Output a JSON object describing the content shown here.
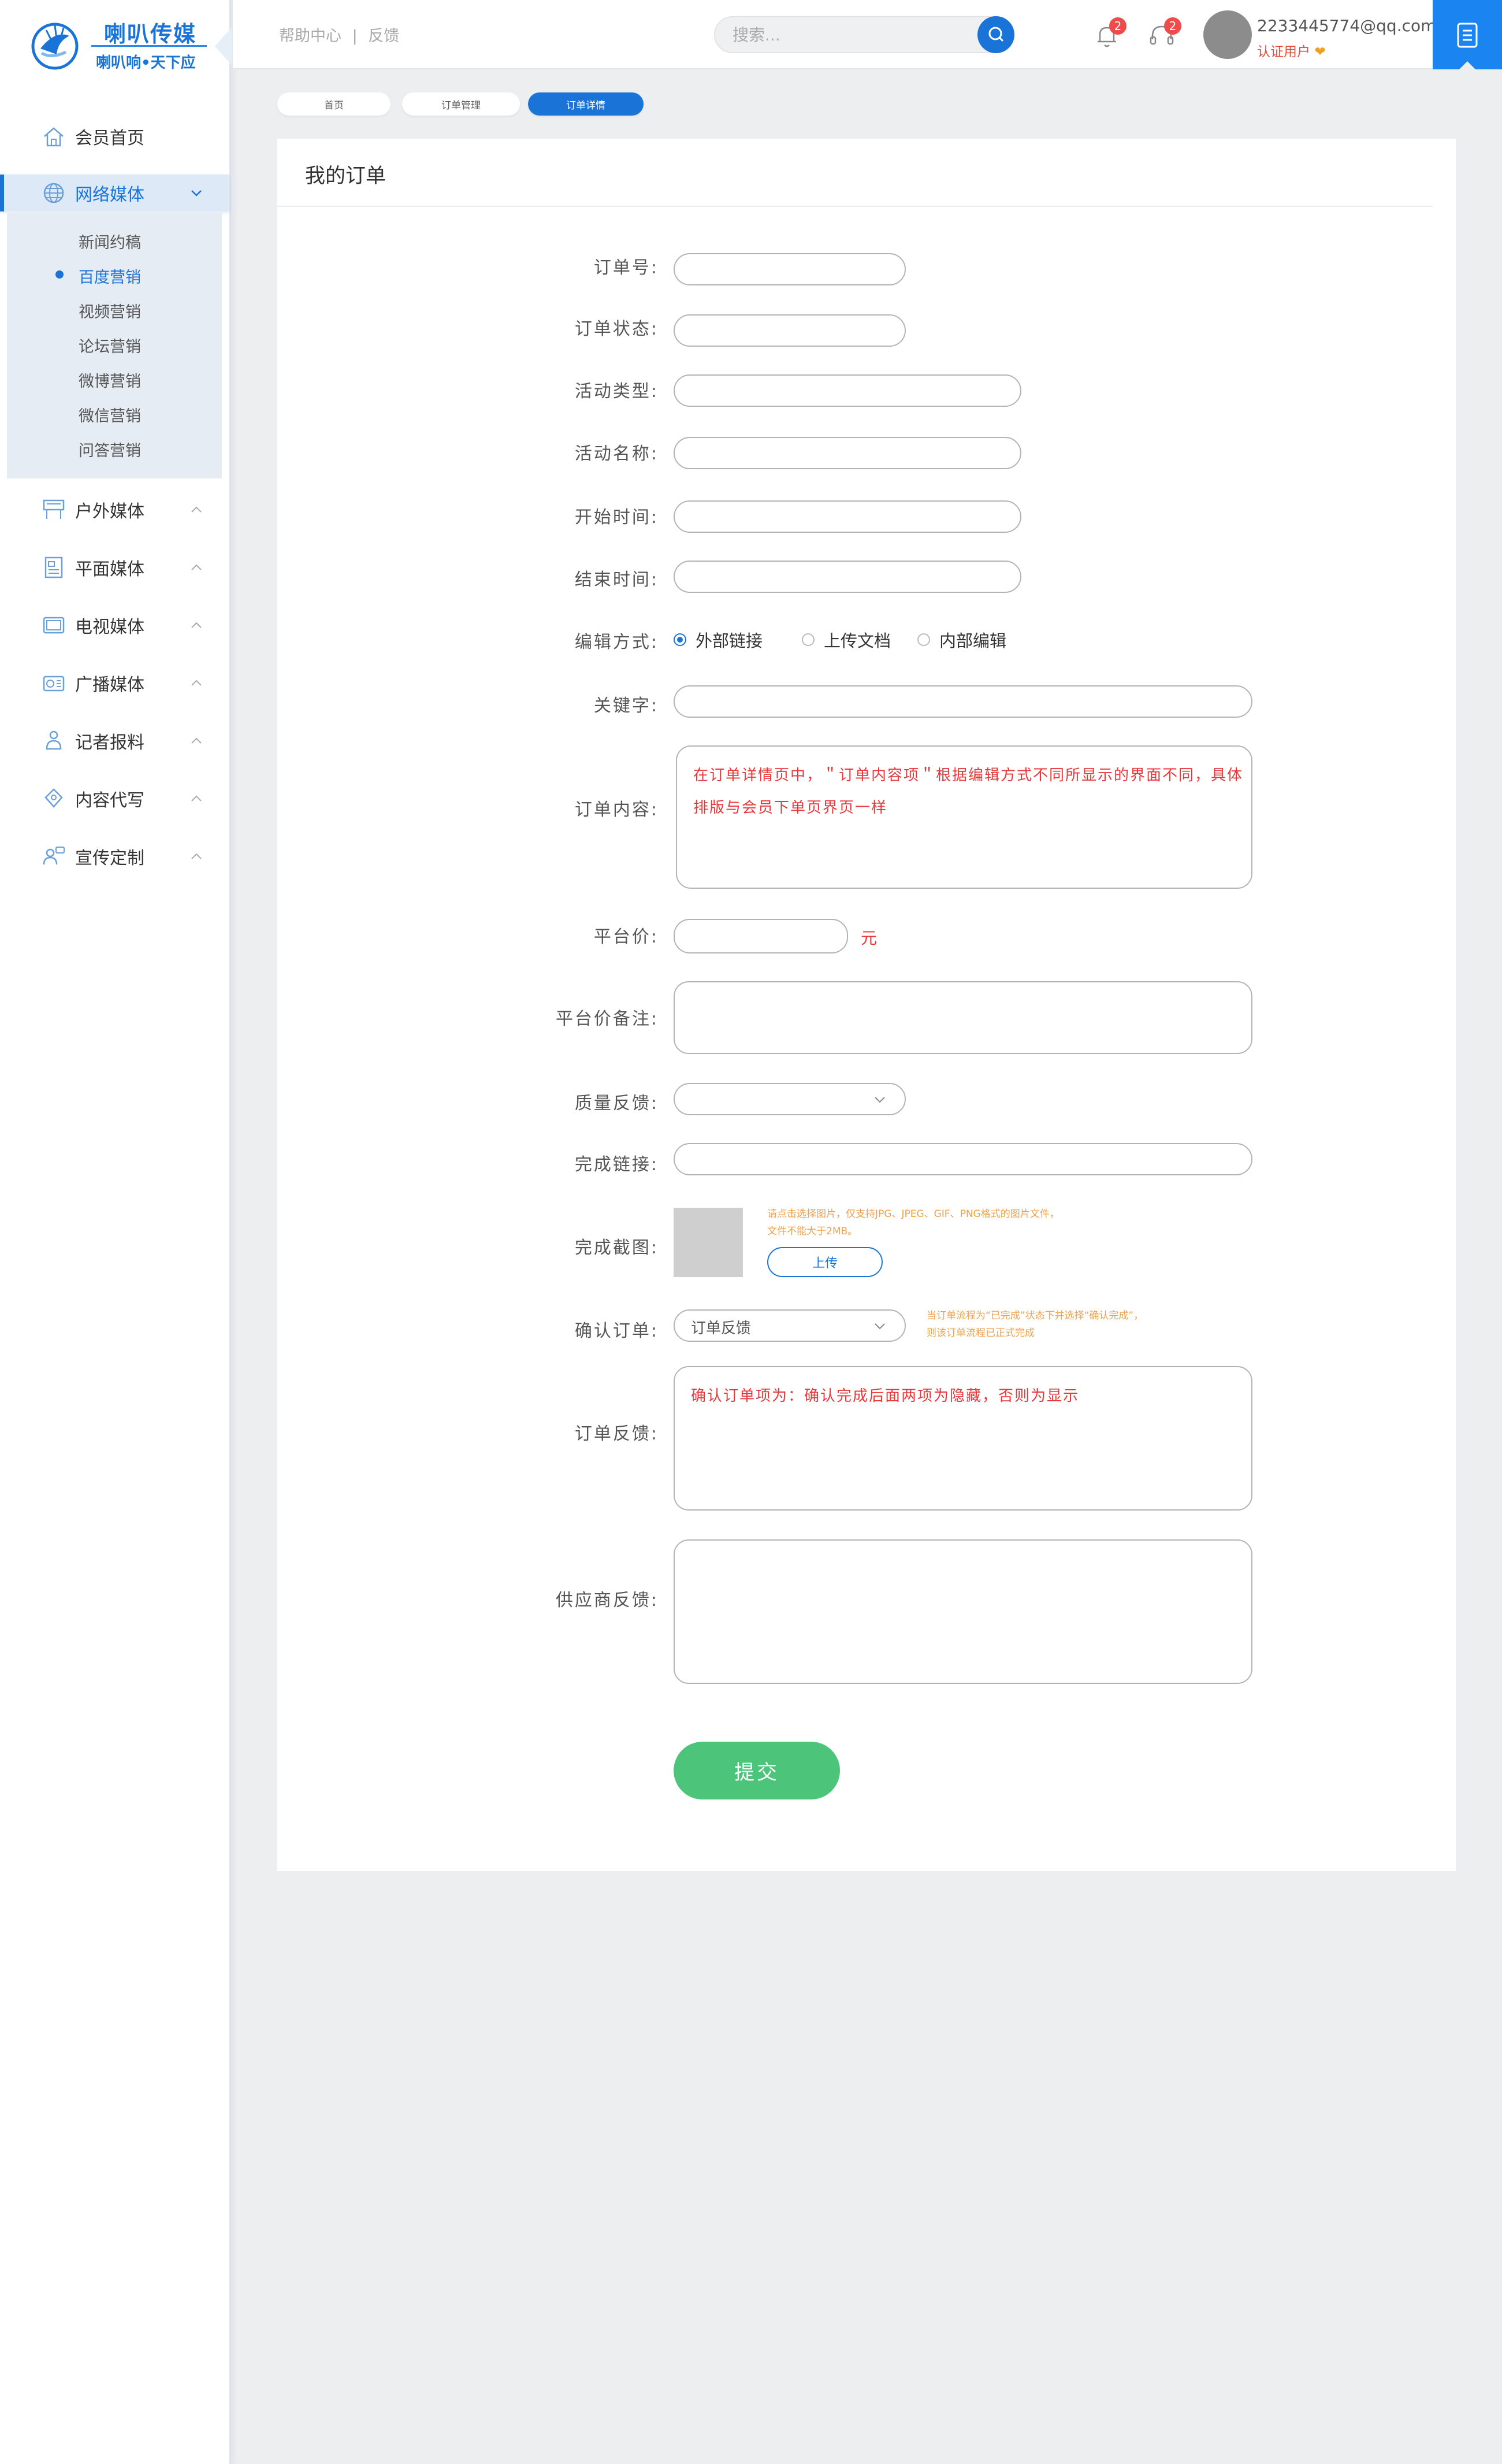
{
  "brand": {
    "title": "喇叭传媒",
    "slogan": "喇叭响•天下应"
  },
  "header": {
    "links": [
      "帮助中心",
      "|",
      "反馈"
    ],
    "search_placeholder": "搜索...",
    "bell_badge": "2",
    "service_badge": "2",
    "user_email": "2233445774@qq.com",
    "user_role": "认证用户",
    "user_role_icon": "heart-badge-icon"
  },
  "sidebar": {
    "items": [
      {
        "label": "会员首页",
        "icon": "home-icon"
      },
      {
        "label": "网络媒体",
        "icon": "globe-icon",
        "active": true,
        "expanded": true
      },
      {
        "label": "户外媒体",
        "icon": "billboard-icon"
      },
      {
        "label": "平面媒体",
        "icon": "newspaper-icon"
      },
      {
        "label": "电视媒体",
        "icon": "tv-icon"
      },
      {
        "label": "广播媒体",
        "icon": "radio-icon"
      },
      {
        "label": "记者报料",
        "icon": "reporter-icon"
      },
      {
        "label": "内容代写",
        "icon": "pen-icon"
      },
      {
        "label": "宣传定制",
        "icon": "custom-icon"
      }
    ],
    "sub_items": [
      "新闻约稿",
      "百度营销",
      "视频营销",
      "论坛营销",
      "微博营销",
      "微信营销",
      "问答营销"
    ],
    "active_sub": 1
  },
  "breadcrumb": [
    "首页",
    "订单管理",
    "订单详情"
  ],
  "panel": {
    "title": "我的订单"
  },
  "form": {
    "order_no_label": "订单号:",
    "order_status_label": "订单状态:",
    "activity_type_label": "活动类型:",
    "activity_name_label": "活动名称:",
    "start_time_label": "开始时间:",
    "end_time_label": "结束时间:",
    "edit_mode_label": "编辑方式:",
    "edit_mode_options": [
      "外部链接",
      "上传文档",
      "内部编辑"
    ],
    "edit_mode_selected": 0,
    "keyword_label": "关键字:",
    "content_label": "订单内容:",
    "content_note": "在订单详情页中，＂订单内容项＂根据编辑方式不同所显示的界面不同，具体排版与会员下单页界页一样",
    "price_label": "平台价:",
    "price_unit": "元",
    "price_note_label": "平台价备注:",
    "quality_label": "质量反馈:",
    "done_link_label": "完成链接:",
    "screenshot_label": "完成截图:",
    "screenshot_tip_1": "请点击选择图片，仅支持JPG、JPEG、GIF、PNG格式的图片文件，",
    "screenshot_tip_2": "文件不能大于2MB。",
    "upload_label": "上传",
    "confirm_label": "确认订单:",
    "confirm_value": "订单反馈",
    "confirm_tip_1": "当订单流程为“已完成”状态下并选择“确认完成”，",
    "confirm_tip_2": "则该订单流程已正式完成",
    "feedback_label": "订单反馈:",
    "feedback_note": "确认订单项为：确认完成后面两项为隐藏，否则为显示",
    "supplier_label": "供应商反馈:",
    "submit_label": "提交"
  }
}
